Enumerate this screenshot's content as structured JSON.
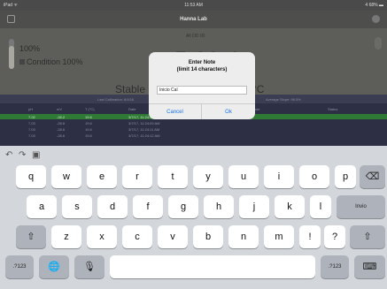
{
  "statusbar": {
    "left": "iPad ᯤ",
    "center": "11:53 AM",
    "right": "4 68% ▬"
  },
  "navbar": {
    "title": "Hanna Lab"
  },
  "info": {
    "battery_pct": "100%",
    "condition": "Condition 100%",
    "sub_label": "All OD 00",
    "big_value": "7.00 4",
    "stable": "Stable",
    "temp_unit": "°C"
  },
  "midbar": {
    "left": "Last Calibration: 8/4/16",
    "right": "Average Slope: 98.5%"
  },
  "table": {
    "headers": [
      "pH",
      "mV",
      "T (°C)",
      "Date",
      "Note",
      "Status"
    ],
    "rows": [
      [
        "7.02",
        "-28.2",
        "19.6",
        "3/7/17, 11:24:46 AM",
        "",
        ""
      ],
      [
        "7.03",
        "-28.6",
        "19.6",
        "3/7/17, 11:24:09 AM",
        "",
        ""
      ],
      [
        "7.03",
        "-28.6",
        "19.6",
        "3/7/17, 11:24:11 AM",
        "",
        ""
      ],
      [
        "7.03",
        "-28.6",
        "19.6",
        "3/7/17, 11:24:12 AM",
        "",
        ""
      ]
    ]
  },
  "alert": {
    "title_line1": "Enter Note",
    "title_line2": "(limit 14 characters)",
    "input_value": "Inicio Cal",
    "cancel": "Cancel",
    "ok": "Ok"
  },
  "keyboard": {
    "row1": [
      "q",
      "w",
      "e",
      "r",
      "t",
      "y",
      "u",
      "i",
      "o",
      "p"
    ],
    "row2": [
      "a",
      "s",
      "d",
      "f",
      "g",
      "h",
      "j",
      "k",
      "l"
    ],
    "row3": [
      "z",
      "x",
      "c",
      "v",
      "b",
      "n",
      "m",
      "!",
      "?"
    ],
    "enter": "Invio",
    "num_left": ".?123",
    "num_right": ".?123",
    "backspace_icon": "⌫",
    "shift_icon": "⇧",
    "globe_icon": "🌐",
    "mic_icon": "🎙",
    "keyboard_icon": "⌨",
    "undo_icon": "↶",
    "redo_icon": "↷",
    "clip_icon": "▣"
  }
}
